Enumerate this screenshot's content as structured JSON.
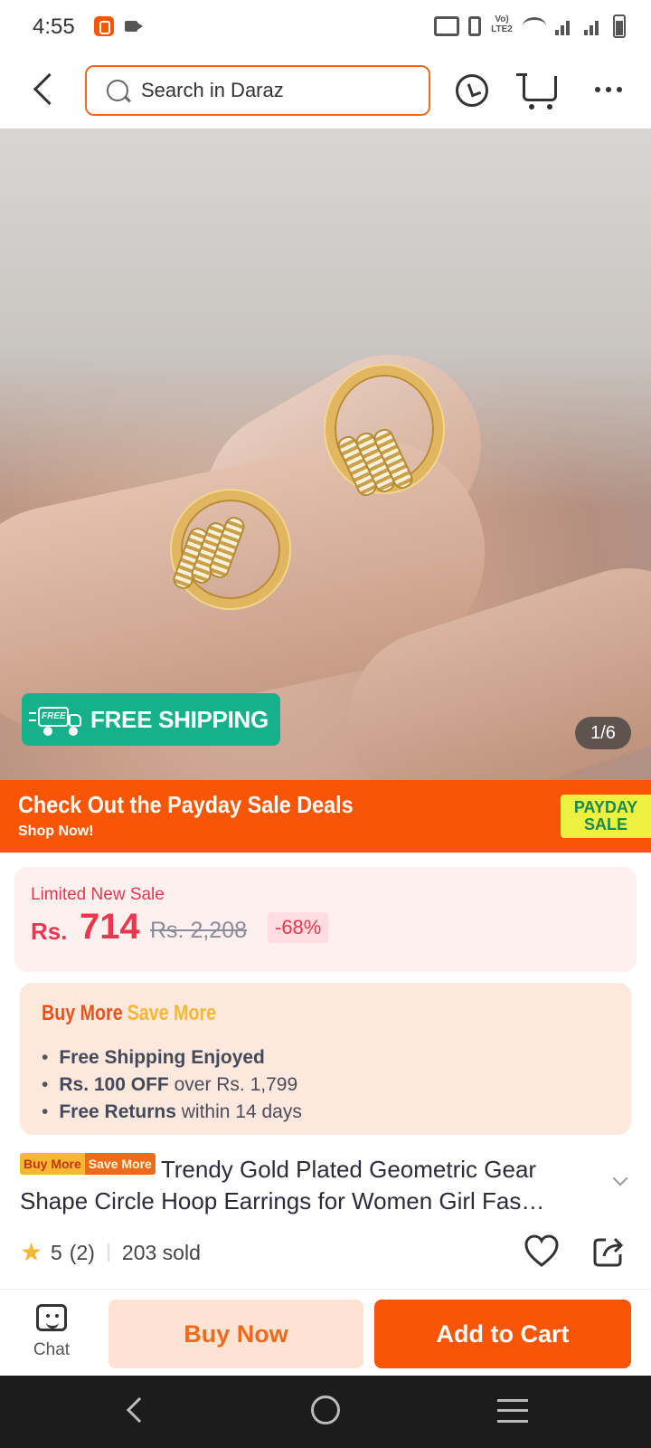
{
  "status_bar": {
    "time": "4:55",
    "volte": "Vo) LTE2"
  },
  "search": {
    "placeholder": "Search in Daraz"
  },
  "product_image": {
    "counter": "1/6",
    "free_shipping_label": "FREE SHIPPING",
    "truck_badge_text": "FREE"
  },
  "banner": {
    "title": "Check Out the Payday Sale Deals",
    "subtitle": "Shop Now!",
    "badge_line1": "PAYDAY",
    "badge_line2": "SALE"
  },
  "price": {
    "sale_label": "Limited New Sale",
    "currency": "Rs.",
    "current": "714",
    "original": "Rs. 2,208",
    "discount": "-68%"
  },
  "buy_more": {
    "title_a": "Buy More",
    "title_b": "Save More",
    "items": [
      {
        "bold": "Free Shipping Enjoyed",
        "rest": ""
      },
      {
        "bold": "Rs. 100 OFF",
        "rest": " over Rs. 1,799"
      },
      {
        "bold": "Free Returns",
        "rest": " within 14 days"
      }
    ]
  },
  "product": {
    "tag_a": "Buy More",
    "tag_b": "Save More",
    "title": "Trendy Gold Plated Geometric Gear Shape Circle Hoop Earrings for Women Girl Fas…",
    "rating": "5",
    "reviews": "(2)",
    "sold": "203 sold"
  },
  "bottom_bar": {
    "chat_label": "Chat",
    "buy_now": "Buy Now",
    "add_to_cart": "Add to Cart"
  },
  "colors": {
    "accent": "#f85606",
    "price": "#e8384f",
    "free_shipping": "#16b18a"
  }
}
